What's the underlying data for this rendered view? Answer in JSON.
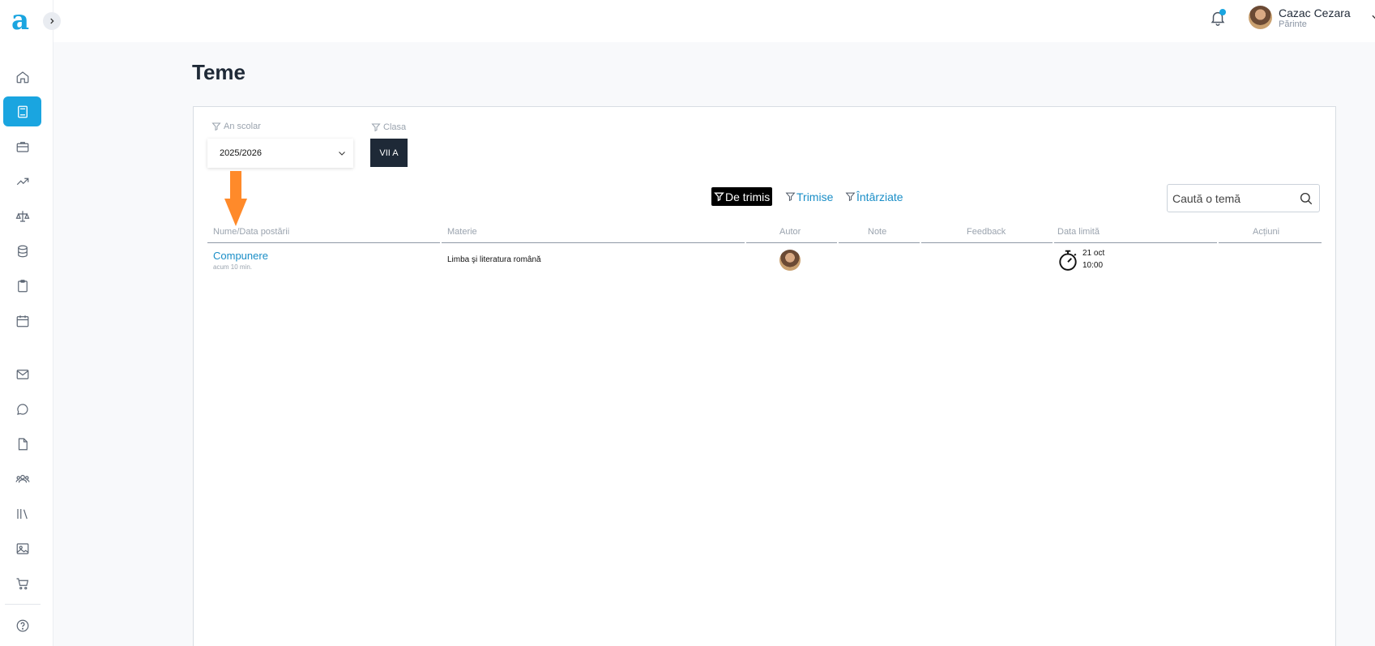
{
  "app": {
    "logo_letter": "a"
  },
  "user": {
    "name": "Cazac Cezara",
    "role": "Părinte"
  },
  "page": {
    "title": "Teme"
  },
  "filters": {
    "year_label": "An scolar",
    "year_value": "2025/2026",
    "class_label": "Clasa",
    "class_value": "VII A"
  },
  "tabs": [
    {
      "label": "De trimis",
      "active": true
    },
    {
      "label": "Trimise",
      "active": false
    },
    {
      "label": "Întârziate",
      "active": false
    }
  ],
  "search": {
    "placeholder": "Caută o temă"
  },
  "table": {
    "columns": [
      "Nume/Data postării",
      "Materie",
      "Autor",
      "Note",
      "Feedback",
      "Data limită",
      "Acțiuni"
    ],
    "rows": [
      {
        "name": "Compunere",
        "posted": "acum 10 min.",
        "subject": "Limba şi literatura română",
        "note": "",
        "feedback": "",
        "deadline_date": "21 oct",
        "deadline_time": "10:00"
      }
    ]
  },
  "colors": {
    "accent": "#1aa5e0",
    "link": "#1a8ec7",
    "dark": "#1e2937",
    "arrow": "#ff8a2a"
  },
  "sidebar_icons": [
    "home-icon",
    "book-icon",
    "briefcase-icon",
    "trending-icon",
    "scale-icon",
    "database-icon",
    "clipboard-icon",
    "calendar-icon",
    "mail-icon",
    "chat-icon",
    "file-icon",
    "users-icon",
    "library-icon",
    "image-icon",
    "cart-icon",
    "help-icon"
  ]
}
